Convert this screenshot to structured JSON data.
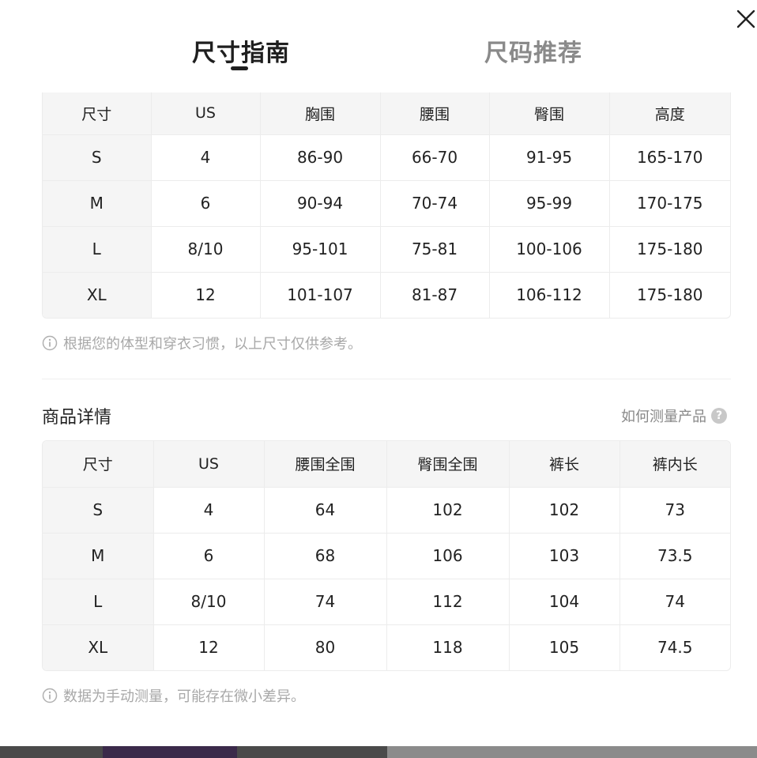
{
  "tabs": {
    "size_guide": "尺寸指南",
    "size_recommend": "尺码推荐"
  },
  "size_table": {
    "headers": [
      "尺寸",
      "US",
      "胸围",
      "腰围",
      "臀围",
      "高度"
    ],
    "rows": [
      [
        "S",
        "4",
        "86-90",
        "66-70",
        "91-95",
        "165-170"
      ],
      [
        "M",
        "6",
        "90-94",
        "70-74",
        "95-99",
        "170-175"
      ],
      [
        "L",
        "8/10",
        "95-101",
        "75-81",
        "100-106",
        "175-180"
      ],
      [
        "XL",
        "12",
        "101-107",
        "81-87",
        "106-112",
        "175-180"
      ]
    ],
    "note": "根据您的体型和穿衣习惯，以上尺寸仅供参考。"
  },
  "product_details": {
    "title": "商品详情",
    "measure_link": "如何测量产品",
    "headers": [
      "尺寸",
      "US",
      "腰围全围",
      "臀围全围",
      "裤长",
      "裤内长"
    ],
    "rows": [
      [
        "S",
        "4",
        "64",
        "102",
        "102",
        "73"
      ],
      [
        "M",
        "6",
        "68",
        "106",
        "103",
        "73.5"
      ],
      [
        "L",
        "8/10",
        "74",
        "112",
        "104",
        "74"
      ],
      [
        "XL",
        "12",
        "80",
        "118",
        "105",
        "74.5"
      ]
    ],
    "note": "数据为手动测量，可能存在微小差异。"
  },
  "icons": {
    "close": "close-icon",
    "info": "info-icon",
    "help": "question-icon"
  }
}
